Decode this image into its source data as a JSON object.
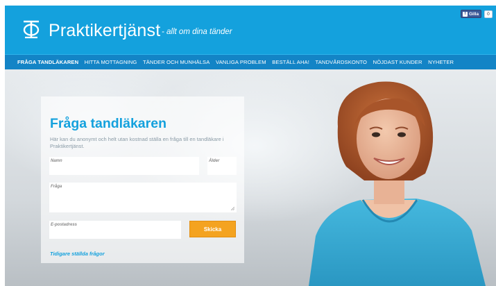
{
  "header": {
    "brand": "Praktikertjänst",
    "tagline": "- allt om dina tänder",
    "facebook": {
      "like_label": "Gilla",
      "like_count": "0"
    }
  },
  "nav": {
    "items": [
      {
        "label": "FRÅGA TANDLÄKAREN",
        "active": true
      },
      {
        "label": "HITTA MOTTAGNING"
      },
      {
        "label": "TÄNDER OCH MUNHÄLSA"
      },
      {
        "label": "VANLIGA PROBLEM"
      },
      {
        "label": "BESTÄLL AHA!"
      },
      {
        "label": "TANDVÅRDSKONTO"
      },
      {
        "label": "NÖJDAST KUNDER"
      },
      {
        "label": "NYHETER"
      }
    ]
  },
  "form": {
    "title": "Fråga tandläkaren",
    "intro": "Här kan du anonymt och helt utan kostnad ställa en fråga till en tandläkare i Praktikertjänst.",
    "name_label": "Namn",
    "age_label": "Ålder",
    "question_label": "Fråga",
    "email_label": "E-postadress",
    "submit_label": "Skicka",
    "previous_link": "Tidigare ställda frågor"
  },
  "colors": {
    "brand_blue": "#14a1dd",
    "nav_blue": "#1384c6",
    "button_orange": "#f4a320"
  },
  "icons": {
    "logo": "praktikertjanst-logo-icon",
    "facebook": "facebook-icon",
    "resize": "resize-handle-icon"
  }
}
